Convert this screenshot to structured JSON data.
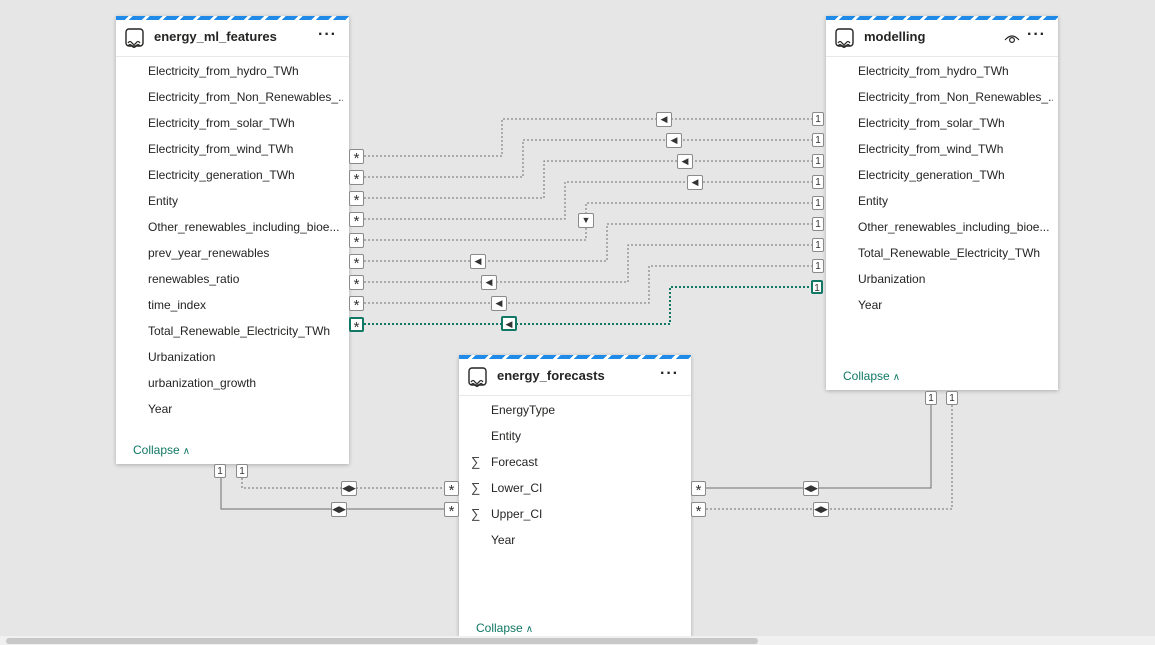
{
  "tables": {
    "energy_ml_features": {
      "title": "energy_ml_features",
      "fields": [
        "Electricity_from_hydro_TWh",
        "Electricity_from_Non_Renewables_...",
        "Electricity_from_solar_TWh",
        "Electricity_from_wind_TWh",
        "Electricity_generation_TWh",
        "Entity",
        "Other_renewables_including_bioe...",
        "prev_year_renewables",
        "renewables_ratio",
        "time_index",
        "Total_Renewable_Electricity_TWh",
        "Urbanization",
        "urbanization_growth",
        "Year"
      ],
      "collapse_label": "Collapse"
    },
    "modelling": {
      "title": "modelling",
      "fields": [
        "Electricity_from_hydro_TWh",
        "Electricity_from_Non_Renewables_...",
        "Electricity_from_solar_TWh",
        "Electricity_from_wind_TWh",
        "Electricity_generation_TWh",
        "Entity",
        "Other_renewables_including_bioe...",
        "Total_Renewable_Electricity_TWh",
        "Urbanization",
        "Year"
      ],
      "collapse_label": "Collapse"
    },
    "energy_forecasts": {
      "title": "energy_forecasts",
      "fields": [
        {
          "name": "EnergyType",
          "sigma": false
        },
        {
          "name": "Entity",
          "sigma": false
        },
        {
          "name": "Forecast",
          "sigma": true
        },
        {
          "name": "Lower_CI",
          "sigma": true
        },
        {
          "name": "Upper_CI",
          "sigma": true
        },
        {
          "name": "Year",
          "sigma": false
        }
      ],
      "collapse_label": "Collapse"
    }
  },
  "cardinality": {
    "many": "*",
    "one": "1"
  },
  "sigma_symbol": "∑",
  "more_symbol": "···",
  "colors": {
    "accent": "#117865",
    "stripe": "#1f8ae8",
    "canvas": "#e6e6e6",
    "line": "#707070"
  }
}
